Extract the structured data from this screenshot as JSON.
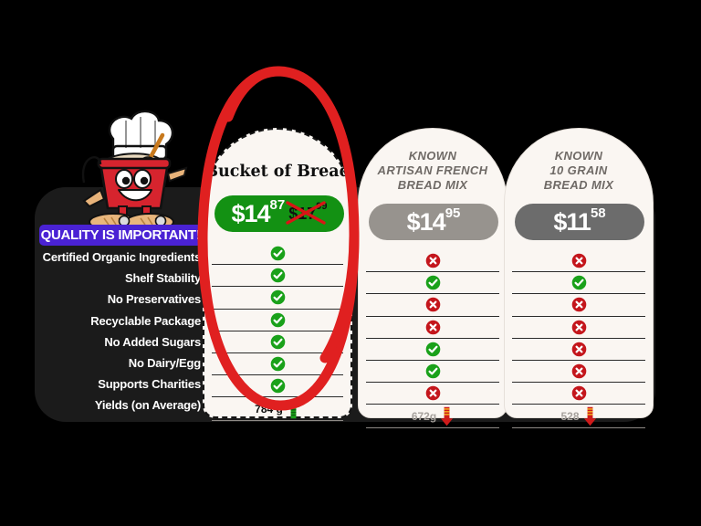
{
  "banner": {
    "text": "QUALITY IS IMPORTANT!",
    "color": "#4a22d4"
  },
  "mascot": {
    "name": "bread-bucket-chef-mascot"
  },
  "features": [
    "Certified Organic Ingredients",
    "Shelf Stability",
    "No Preservatives",
    "Recyclable Package",
    "No Added Sugars",
    "No Dairy/Egg",
    "Supports Charities",
    "Yields (on Average)"
  ],
  "colors": {
    "check_green": "#1aa11a",
    "cross_red": "#c4161c",
    "annotation_red": "#e02020",
    "panel_dark": "#1b1b1b",
    "card_cream": "#faf6f2"
  },
  "products": [
    {
      "id": "bucket-of-bread",
      "title_lines": [
        "Bucket of Bread"
      ],
      "price_main": "$14",
      "price_cents": "87",
      "price_old": "$17",
      "price_old_cents": "99",
      "has_old_price": true,
      "pill_color": "#139113",
      "highlighted": true,
      "marks": [
        "check",
        "check",
        "check",
        "check",
        "check",
        "check",
        "check"
      ],
      "yield": "784 g",
      "yield_trend": "up"
    },
    {
      "id": "known-artisan-french-bread-mix",
      "title_lines": [
        "KNOWN",
        "ARTISAN FRENCH",
        "BREAD MIX"
      ],
      "price_main": "$14",
      "price_cents": "95",
      "has_old_price": false,
      "pill_color": "#97938e",
      "highlighted": false,
      "marks": [
        "cross",
        "check",
        "cross",
        "cross",
        "check",
        "check",
        "cross"
      ],
      "yield": "672g",
      "yield_trend": "down"
    },
    {
      "id": "known-10-grain-bread-mix",
      "title_lines": [
        "KNOWN",
        "10 GRAIN",
        "BREAD MIX"
      ],
      "price_main": "$11",
      "price_cents": "58",
      "has_old_price": false,
      "pill_color": "#6c6c6c",
      "highlighted": false,
      "marks": [
        "cross",
        "check",
        "cross",
        "cross",
        "cross",
        "cross",
        "cross"
      ],
      "yield": "528",
      "yield_trend": "down"
    }
  ]
}
